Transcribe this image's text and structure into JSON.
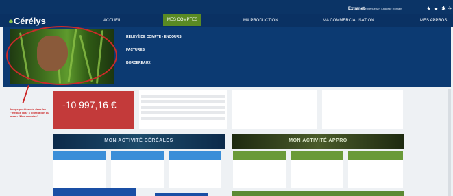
{
  "topbar": {
    "extranet": "Extranet",
    "user": "Bienvenue MR Laquelle Romain",
    "icons": [
      "star-icon",
      "user-icon",
      "settings-icon",
      "twitter-icon"
    ]
  },
  "logo": "Cérélys",
  "nav": {
    "accueil": "ACCUEIL",
    "mes_comptes": "MES COMPTES",
    "ma_production": "MA PRODUCTION",
    "ma_commercialisation": "MA COMMERCIALISATION",
    "mes_appros": "MES APPROS"
  },
  "dropdown": {
    "items": [
      "RELEVÉ DE COMPTE - ENCOURS",
      "FACTURES",
      "BORDEREAUX"
    ]
  },
  "annotation": "Image positionnée dans les \"medias libs\" = illustration du menu \"Mes comptes\"",
  "balance": "-10 997,16 €",
  "activities": {
    "cereales": "MON ACTIVITÉ CÉRÉALES",
    "appro": "MON ACTIVITÉ APPRO"
  },
  "colors": {
    "nav_bg": "#0a3163",
    "accent_green": "#5a8a23",
    "balance_red": "#c33a3a",
    "annotation_red": "#cc2a2a"
  }
}
